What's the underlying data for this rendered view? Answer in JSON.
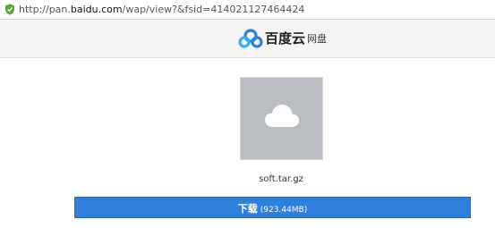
{
  "address_bar": {
    "url_prefix": "http://pan.",
    "url_domain": "baidu.com",
    "url_suffix": "/wap/view?&fsid=414021127464424",
    "security_icon": "shield-check-icon"
  },
  "header": {
    "brand": "百度云",
    "sub": "网盘",
    "logo_icon": "baidu-cloud-logo-icon",
    "brand_color": "#2f7fdc"
  },
  "file": {
    "thumbnail_icon": "cloud-icon",
    "name": "soft.tar.gz"
  },
  "download": {
    "label": "下载",
    "size": "(923.44MB)",
    "color": "#2f7fdc"
  }
}
